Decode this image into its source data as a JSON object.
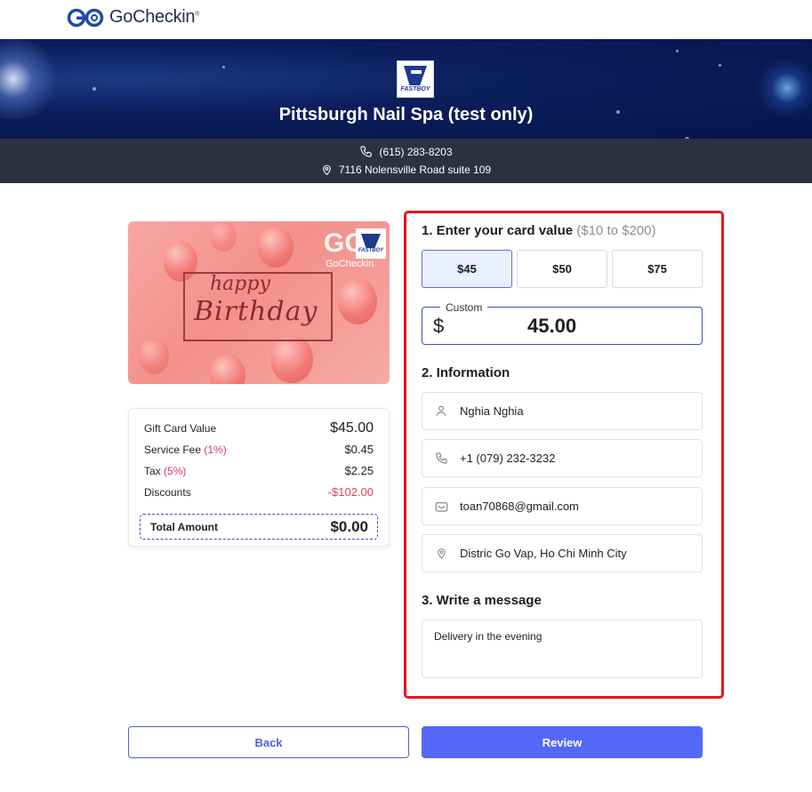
{
  "brand": {
    "name": "GoCheckin",
    "registered": "®"
  },
  "shop": {
    "logo_text": "FASTBOY",
    "name": "Pittsburgh Nail Spa (test only)",
    "phone": "(615) 283-8203",
    "address": "7116 Nolensville Road suite 109"
  },
  "giftcard": {
    "line1": "happy",
    "line2": "Birthday",
    "logo_go": "GO",
    "logo_text": "GoCheckin",
    "shop_badge": "FASTBOY"
  },
  "summary": {
    "rows": [
      {
        "label": "Gift Card Value",
        "pct": "",
        "value": "$45.00"
      },
      {
        "label": "Service Fee",
        "pct": "(1%)",
        "value": "$0.45"
      },
      {
        "label": "Tax",
        "pct": "(5%)",
        "value": "$2.25"
      },
      {
        "label": "Discounts",
        "pct": "",
        "value": "-$102.00"
      }
    ],
    "total_label": "Total Amount",
    "total_value": "$0.00"
  },
  "step1": {
    "title": "1. Enter your card value",
    "range": "($10 to $200)",
    "amounts": [
      "$45",
      "$50",
      "$75"
    ],
    "selected_index": 0,
    "custom_label": "Custom",
    "currency": "$",
    "custom_value": "45.00"
  },
  "step2": {
    "title": "2. Information",
    "name": "Nghia Nghia",
    "phone": "+1 (079) 232-3232",
    "email": "toan70868@gmail.com",
    "address": "Distric Go Vap, Ho Chi Minh City"
  },
  "step3": {
    "title": "3. Write a message",
    "message": "Delivery in the evening"
  },
  "actions": {
    "back": "Back",
    "review": "Review"
  },
  "colors": {
    "accent": "#5468f7",
    "highlight_border": "#e3161b",
    "hero": "#0b1e5c",
    "contact_bar": "#2d3142",
    "discount": "#e0405f"
  }
}
